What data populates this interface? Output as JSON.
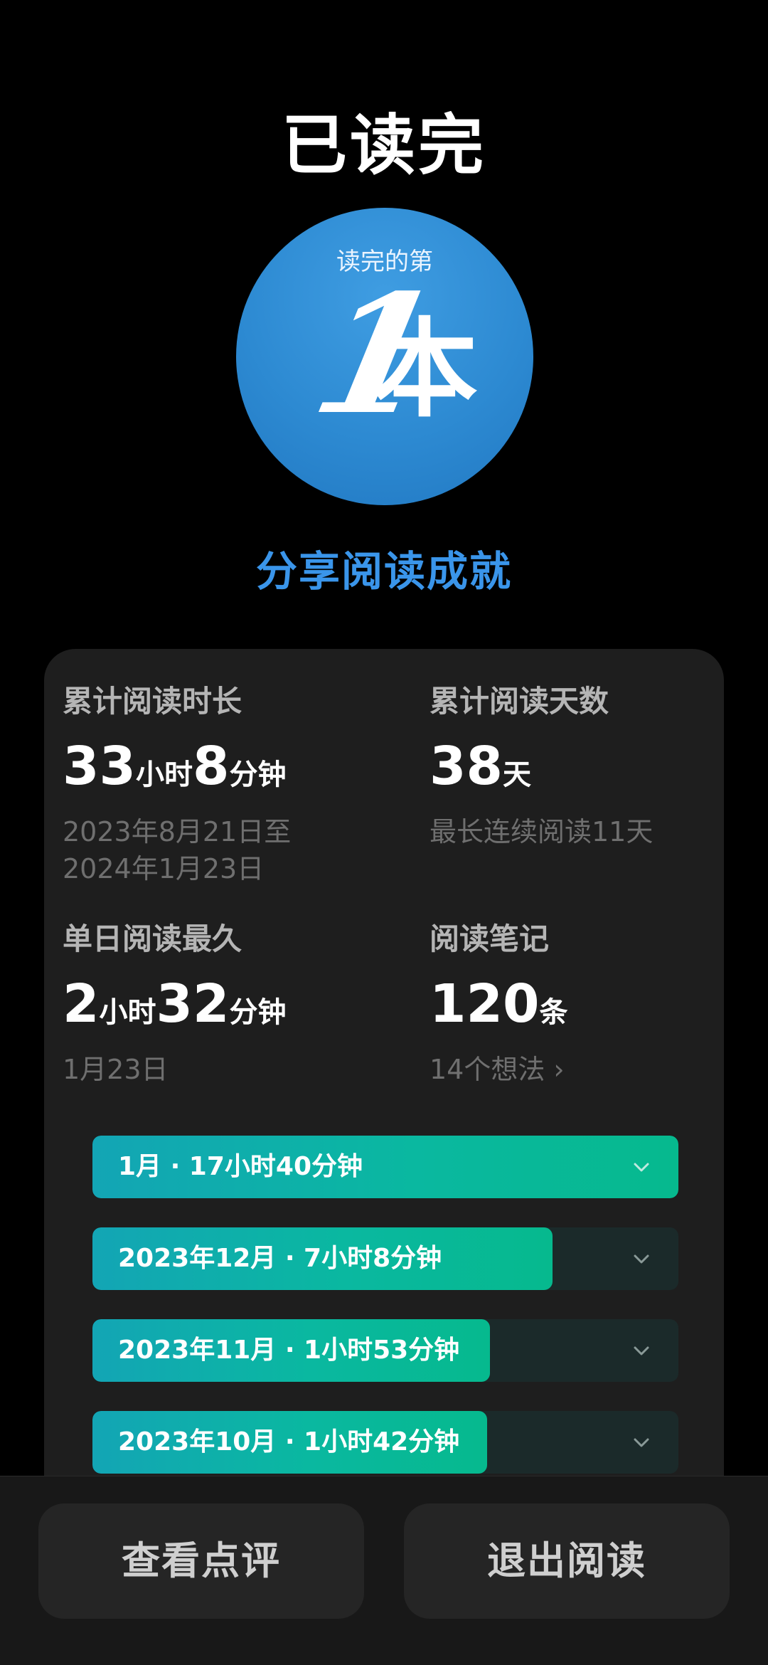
{
  "header": {
    "title": "已读完"
  },
  "badge": {
    "top_text": "读完的第",
    "number": "1",
    "unit": "本"
  },
  "share": {
    "label": "分享阅读成就"
  },
  "stats": {
    "total_time": {
      "label": "累计阅读时长",
      "hours": "33",
      "hours_unit": "小时",
      "minutes": "8",
      "minutes_unit": "分钟",
      "range_line1": "2023年8月21日至",
      "range_line2": "2024年1月23日"
    },
    "total_days": {
      "label": "累计阅读天数",
      "value": "38",
      "unit": "天",
      "sub": "最长连续阅读11天"
    },
    "longest_day": {
      "label": "单日阅读最久",
      "hours": "2",
      "hours_unit": "小时",
      "minutes": "32",
      "minutes_unit": "分钟",
      "date": "1月23日"
    },
    "notes": {
      "label": "阅读笔记",
      "value": "120",
      "unit": "条",
      "sub": "14个想法 ›"
    }
  },
  "months": [
    {
      "label": "1月 · 17小时40分钟",
      "fraction": 1.0
    },
    {
      "label": "2023年12月 · 7小时8分钟",
      "fraction": 0.785
    },
    {
      "label": "2023年11月 · 1小时53分钟",
      "fraction": 0.678
    },
    {
      "label": "2023年10月 · 1小时42分钟",
      "fraction": 0.674
    }
  ],
  "buttons": {
    "review": "查看点评",
    "exit": "退出阅读"
  },
  "colors": {
    "accent_blue": "#3a95ea",
    "bar_start": "#13a5b5",
    "bar_end": "#06b98e",
    "card": "#1e1e1e"
  },
  "icons": {
    "month_expand": "chevron-down-icon"
  }
}
